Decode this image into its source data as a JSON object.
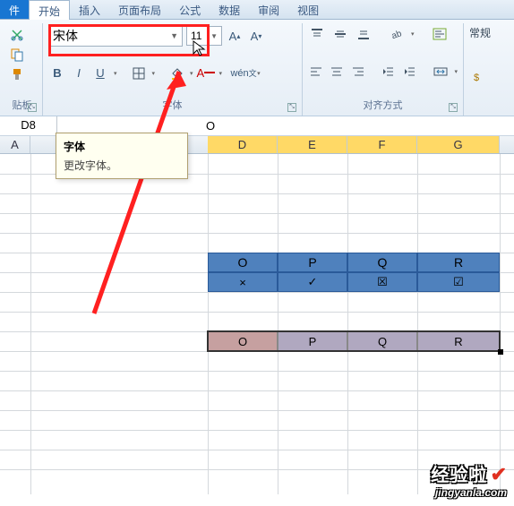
{
  "tabs": {
    "file": "件",
    "home": "开始",
    "insert": "插入",
    "layout": "页面布局",
    "formulas": "公式",
    "data": "数据",
    "review": "审阅",
    "view": "视图"
  },
  "ribbon": {
    "clipboard_label": "贴板",
    "font_name": "宋体",
    "font_size": "11",
    "font_label": "字体",
    "align_label": "对齐方式",
    "normal_style": "常规"
  },
  "tooltip": {
    "title": "字体",
    "body": "更改字体。"
  },
  "namebox": "D8",
  "formula_value": "O",
  "columns": [
    "A",
    "D",
    "E",
    "F",
    "G"
  ],
  "blue_table": {
    "headers": [
      "O",
      "P",
      "Q",
      "R"
    ],
    "row_symbols": [
      "×",
      "✓",
      "☒",
      "☑"
    ]
  },
  "selected_row": [
    "O",
    "P",
    "Q",
    "R"
  ],
  "watermark": {
    "big": "经验啦",
    "small": "jingyanla.com"
  }
}
